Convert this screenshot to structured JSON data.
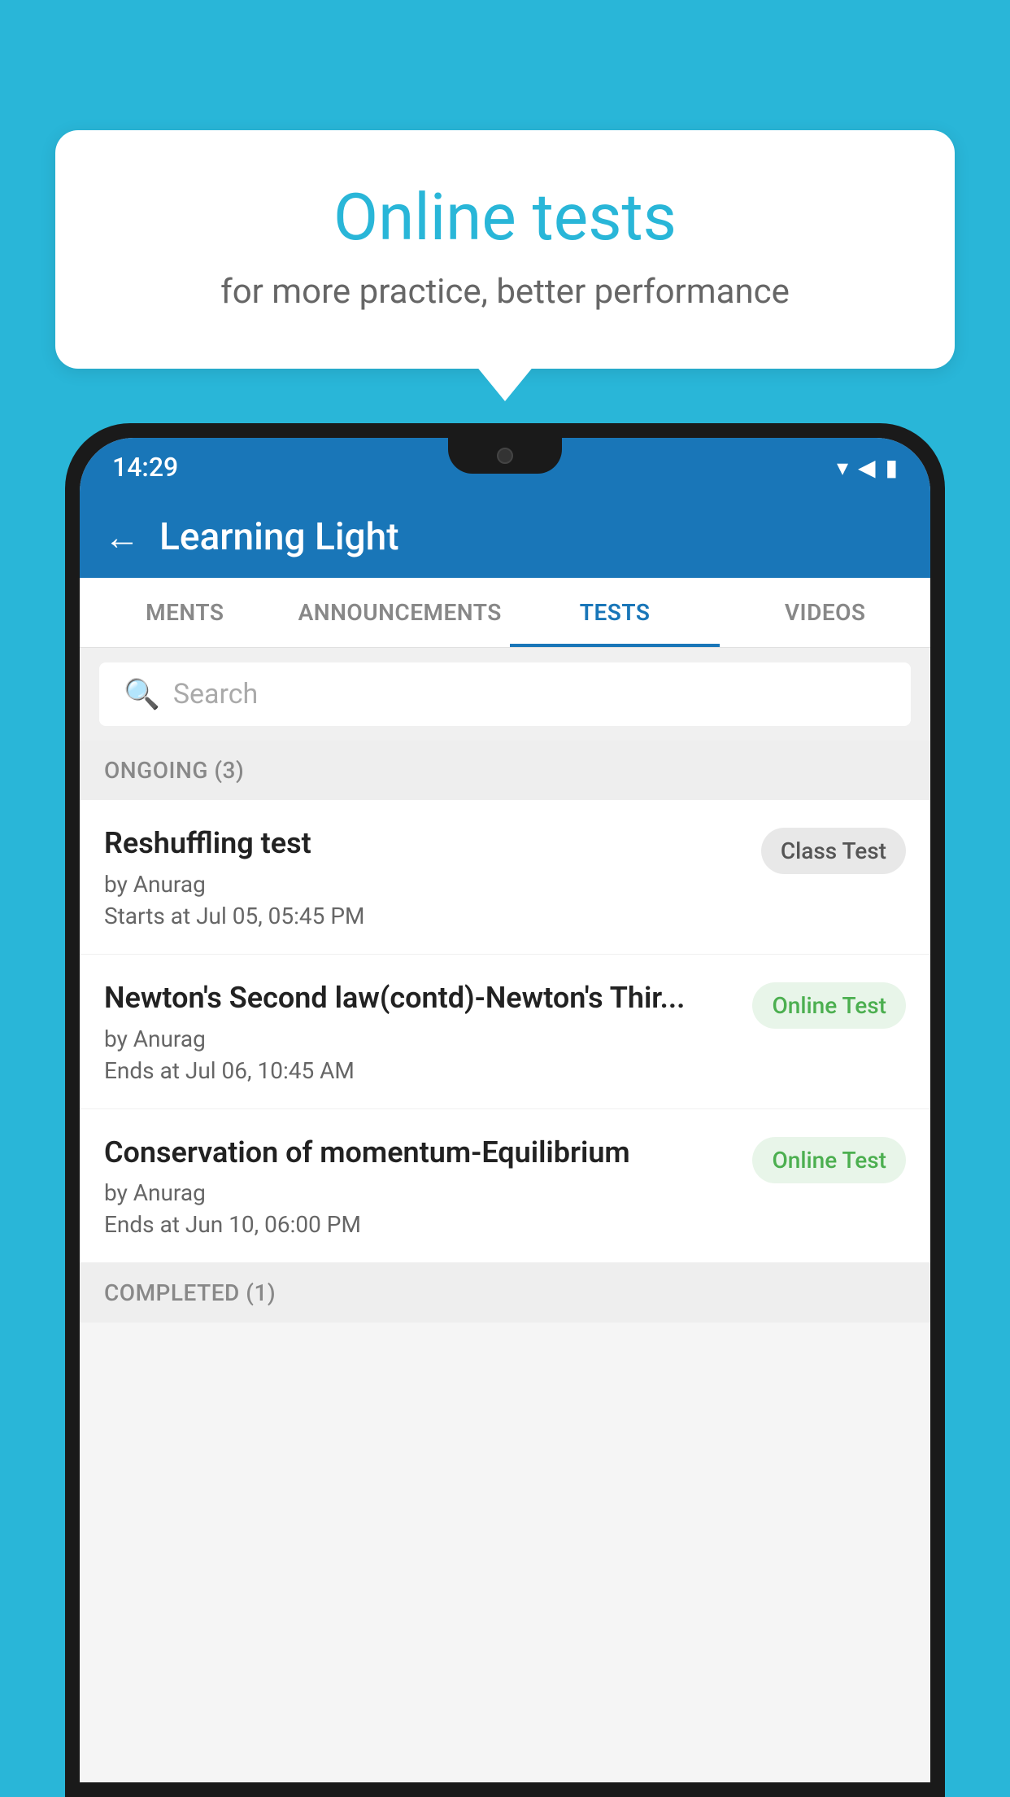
{
  "background": {
    "color": "#29b6d8"
  },
  "speech_bubble": {
    "title": "Online tests",
    "subtitle": "for more practice, better performance"
  },
  "phone": {
    "status_bar": {
      "time": "14:29",
      "icons": [
        "wifi",
        "signal",
        "battery"
      ]
    },
    "app_bar": {
      "back_label": "←",
      "title": "Learning Light"
    },
    "tabs": [
      {
        "label": "MENTS",
        "active": false
      },
      {
        "label": "ANNOUNCEMENTS",
        "active": false
      },
      {
        "label": "TESTS",
        "active": true
      },
      {
        "label": "VIDEOS",
        "active": false
      }
    ],
    "search": {
      "placeholder": "Search"
    },
    "sections": [
      {
        "header": "ONGOING (3)",
        "items": [
          {
            "name": "Reshuffling test",
            "by": "by Anurag",
            "date": "Starts at  Jul 05, 05:45 PM",
            "badge": "Class Test",
            "badge_type": "class"
          },
          {
            "name": "Newton's Second law(contd)-Newton's Thir...",
            "by": "by Anurag",
            "date": "Ends at  Jul 06, 10:45 AM",
            "badge": "Online Test",
            "badge_type": "online"
          },
          {
            "name": "Conservation of momentum-Equilibrium",
            "by": "by Anurag",
            "date": "Ends at  Jun 10, 06:00 PM",
            "badge": "Online Test",
            "badge_type": "online"
          }
        ]
      }
    ],
    "completed_header": "COMPLETED (1)"
  }
}
